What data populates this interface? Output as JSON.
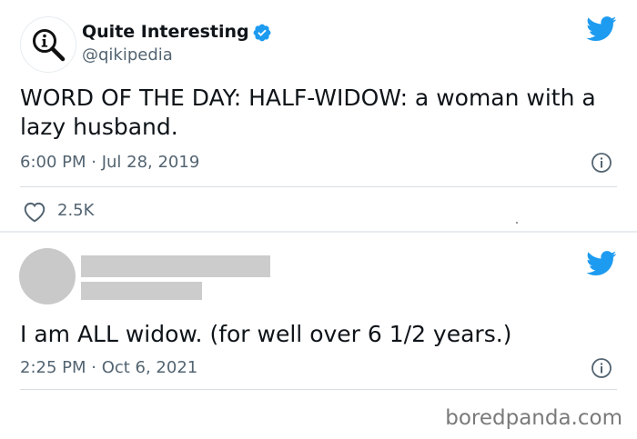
{
  "colors": {
    "twitter_blue": "#1d9bf0",
    "text_primary": "#0f1419",
    "text_secondary": "#536471",
    "redaction_gray": "#cccccc"
  },
  "tweet1": {
    "display_name": "Quite Interesting",
    "handle": "@qikipedia",
    "verified": true,
    "text": "WORD OF THE DAY: HALF-WIDOW: a woman with a\nlazy husband.",
    "timestamp": "6:00 PM · Jul 28, 2019",
    "likes": "2.5K",
    "icons": [
      "qi-logo-icon",
      "verified-badge-icon",
      "twitter-bird-icon",
      "info-icon",
      "heart-icon"
    ]
  },
  "tweet2": {
    "text": "I am ALL widow. (for well over 6 1/2 years.)",
    "timestamp": "2:25 PM · Oct 6, 2021",
    "icons": [
      "twitter-bird-icon",
      "info-icon"
    ]
  },
  "watermark": "boredpanda.com"
}
